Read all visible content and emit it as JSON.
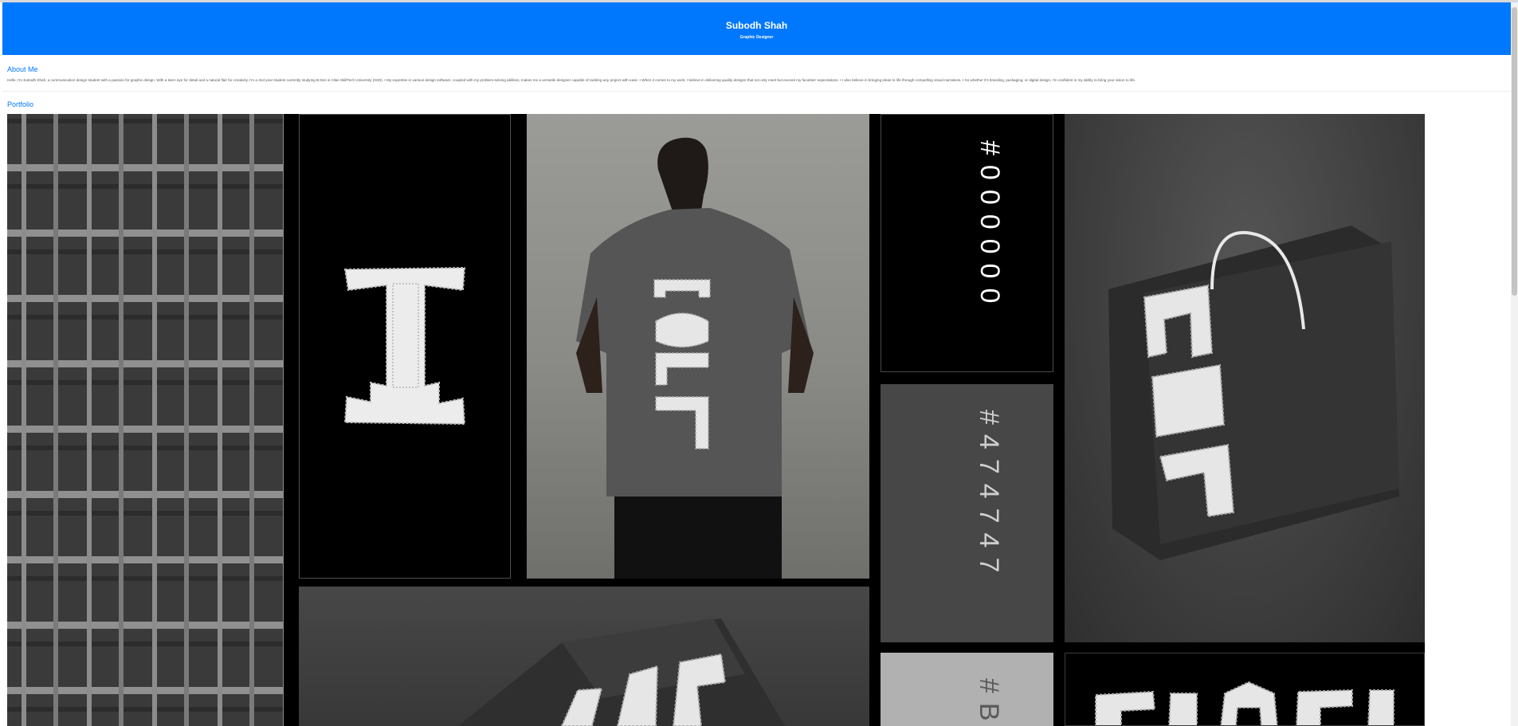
{
  "header": {
    "name": "Subodh Shah",
    "role": "Graphic Designer",
    "color": "#0078fe"
  },
  "about": {
    "title": "About Me",
    "text": "Hello, I'm Subodh Shah, a communication design student with a passion for graphic design. With a keen eye for detail and a natural flair for creativity, I'm a 2nd year student currently studying B.Des in Atlas SkillTech University (ISDI). • My expertise in various design software, coupled with my problem-solving abilities, makes me a versatile designer capable of tackling any project with ease. • When it comes to my work, I believe in delivering quality designs that not only meet but exceed my faculties' expectations. • I also believe in bringing ideas to life through compelling visual narratives. • So whether it's branding, packaging, or digital design, I'm confident in my ability to bring your vision to life."
  },
  "portfolio": {
    "title": "Portfolio",
    "swatches": [
      {
        "label": "#000000",
        "color": "#000000"
      },
      {
        "label": "#474747",
        "color": "#474747"
      },
      {
        "label": "#B",
        "color": "#b1b1b1"
      }
    ],
    "images": [
      "monogram-pattern",
      "monogram-logo",
      "tshirt-back-photo",
      "shopping-bag-mockup",
      "box-packaging-mockup",
      "wordmark-banner"
    ]
  }
}
